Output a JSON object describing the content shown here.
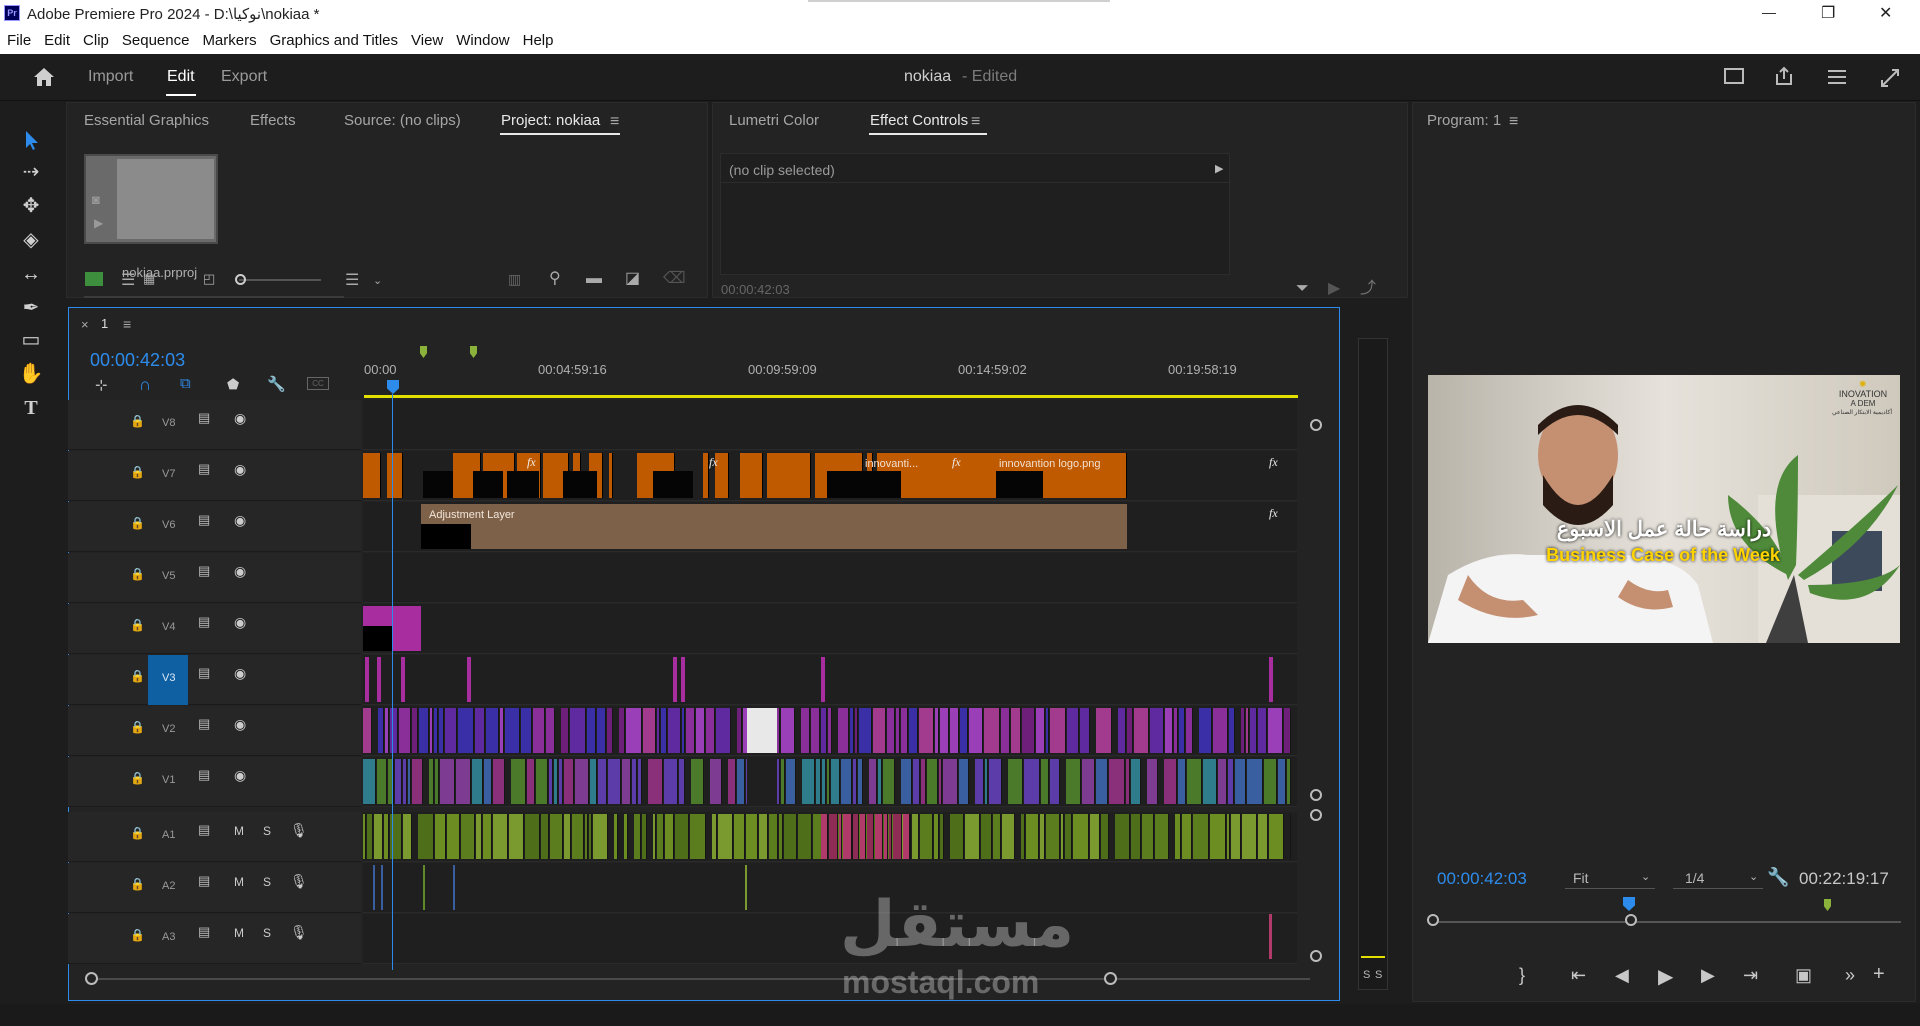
{
  "window": {
    "title": "Adobe Premiere Pro 2024 - D:\\نوكيا\\nokiaa *",
    "app_icon": "Pr",
    "controls": [
      "—",
      "❐",
      "✕"
    ]
  },
  "menu": [
    "File",
    "Edit",
    "Clip",
    "Sequence",
    "Markers",
    "Graphics and Titles",
    "View",
    "Window",
    "Help"
  ],
  "header": {
    "tabs": [
      "Import",
      "Edit",
      "Export"
    ],
    "active_tab": "Edit",
    "project_name": "nokiaa",
    "project_status": "- Edited"
  },
  "project_panel": {
    "tabs": [
      "Essential Graphics",
      "Effects",
      "Source: (no clips)",
      "Project: nokiaa"
    ],
    "active_tab": "Project: nokiaa",
    "item_name": "nokiaa.prproj"
  },
  "effect_panel": {
    "tabs": [
      "Lumetri Color",
      "Effect Controls"
    ],
    "active_tab": "Effect Controls",
    "no_clip": "(no clip selected)",
    "timecode": "00:00:42:03"
  },
  "program": {
    "title": "Program: 1",
    "timecode": "00:00:42:03",
    "fit": "Fit",
    "resolution": "1/4",
    "duration": "00:22:19:17",
    "overlay_arabic": "دراسة حالة عمل الاسبوع",
    "overlay_english": "Business Case of the Week",
    "logo_line1": "INOVATION",
    "logo_line2": "A   DEM",
    "logo_line3": "أكاديمية الابتكار الصناعي"
  },
  "timeline": {
    "tab_close": "×",
    "sequence_name": "1",
    "timecode": "00:00:42:03",
    "ruler": [
      "00:00",
      "00:04:59:16",
      "00:09:59:09",
      "00:14:59:02",
      "00:19:58:19"
    ],
    "video_tracks": [
      "V8",
      "V7",
      "V6",
      "V5",
      "V4",
      "V3",
      "V2",
      "V1"
    ],
    "audio_tracks": [
      "A1",
      "A2",
      "A3"
    ],
    "audio_buttons": [
      "M",
      "S"
    ],
    "clip_labels": {
      "adjustment": "Adjustment Layer",
      "logo": "innovantion logo.png",
      "innovanti": "innovanti...",
      "fx": "fx"
    },
    "meter_labels": [
      "S",
      "S"
    ]
  },
  "watermark": {
    "arabic": "مستقل",
    "latin": "mostaql.com"
  },
  "colors": {
    "accent_blue": "#2d8ceb",
    "clip_orange": "#c05a00",
    "adjustment": "#7d6148",
    "clip_magenta": "#a82ea0",
    "audio_green": "#5b7d1e",
    "audio_pink": "#b03a6a",
    "work_area_yellow": "#e3e000"
  }
}
